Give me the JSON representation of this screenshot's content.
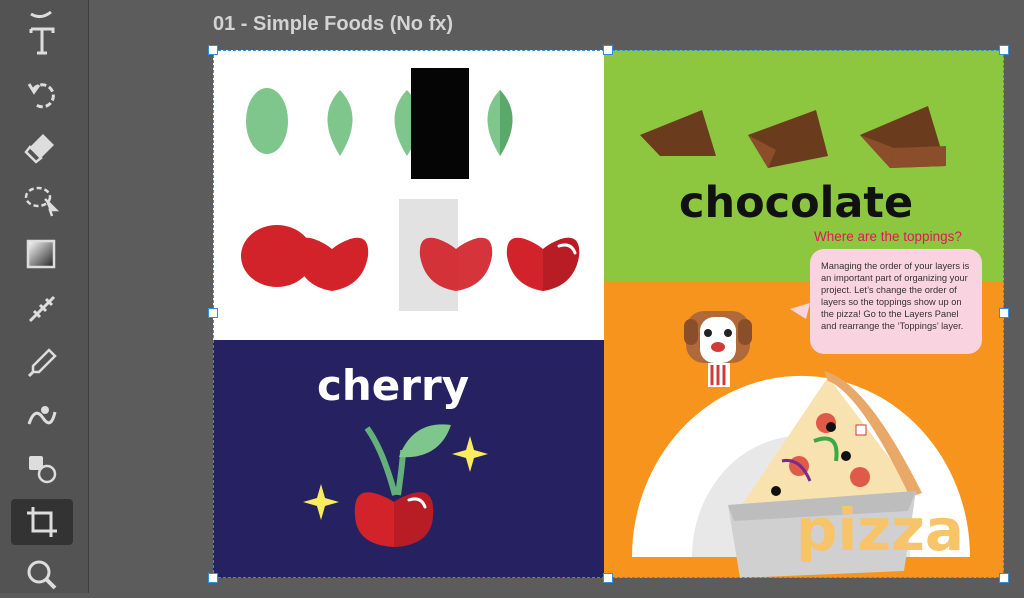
{
  "document": {
    "artboard_title": "01 - Simple Foods (No fx)"
  },
  "toolbar": {
    "tools": [
      {
        "name": "pen-tool"
      },
      {
        "name": "type-tool"
      },
      {
        "name": "rotate-view-tool"
      },
      {
        "name": "eraser-tool"
      },
      {
        "name": "lasso-tool"
      },
      {
        "name": "gradient-tool"
      },
      {
        "name": "eyedropper-tool"
      },
      {
        "name": "warp-tool"
      },
      {
        "name": "clone-tool"
      },
      {
        "name": "crop-tool",
        "active": true
      },
      {
        "name": "zoom-tool"
      }
    ]
  },
  "artboard": {
    "chocolate_label": "chocolate",
    "cherry_label": "cherry",
    "pizza_label": "pizza",
    "toppings_question": "Where are the toppings?",
    "instructions": "Managing the order of your layers is an important part of organizing your project. Let’s change the order of layers so the toppings show up on the pizza! Go to the Layers Panel and rearrange the ‘Toppings’ layer."
  },
  "colors": {
    "green_bg": "#8dc63f",
    "orange_bg": "#f7941d",
    "navy_bg": "#262262",
    "selection": "#2f8fe0",
    "cherry_red": "#d2232a",
    "leaf_green": "#7ec68b",
    "question_pink": "#e0185e"
  }
}
